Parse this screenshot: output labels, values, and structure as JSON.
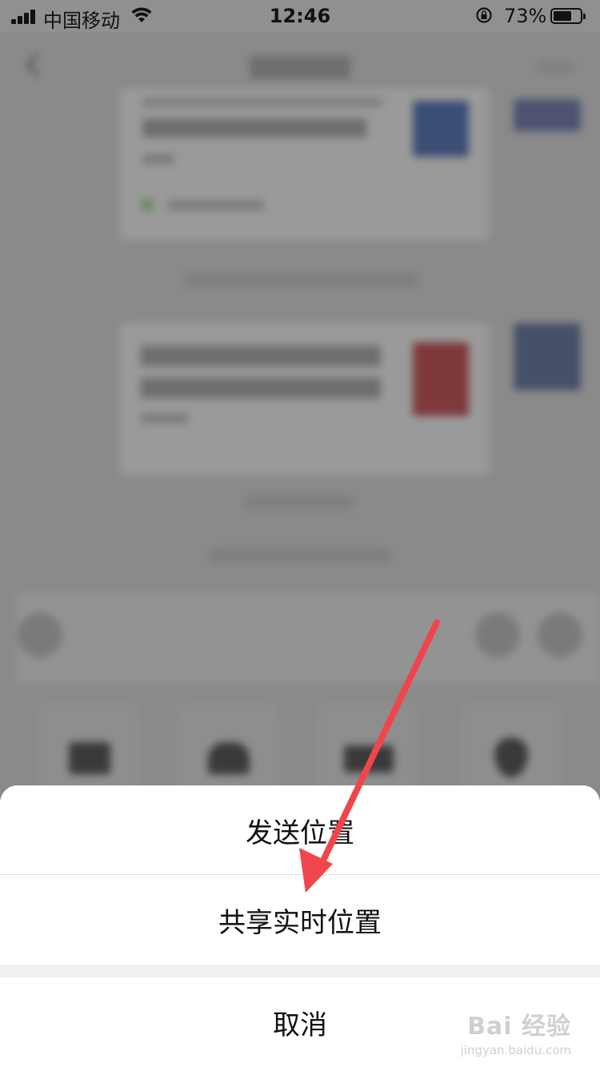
{
  "status_bar": {
    "carrier": "中国移动",
    "time": "12:46",
    "battery_percent_label": "73%",
    "battery_level": 0.73
  },
  "action_sheet": {
    "send_location": "发送位置",
    "share_live_location": "共享实时位置",
    "cancel": "取消"
  },
  "watermark": {
    "brand": "Bai 经验",
    "site": "jingyan.baidu.com"
  },
  "colors": {
    "overlay": "#8a8a8a",
    "sheet_background": "#ffffff",
    "arrow": "#f0454b"
  }
}
